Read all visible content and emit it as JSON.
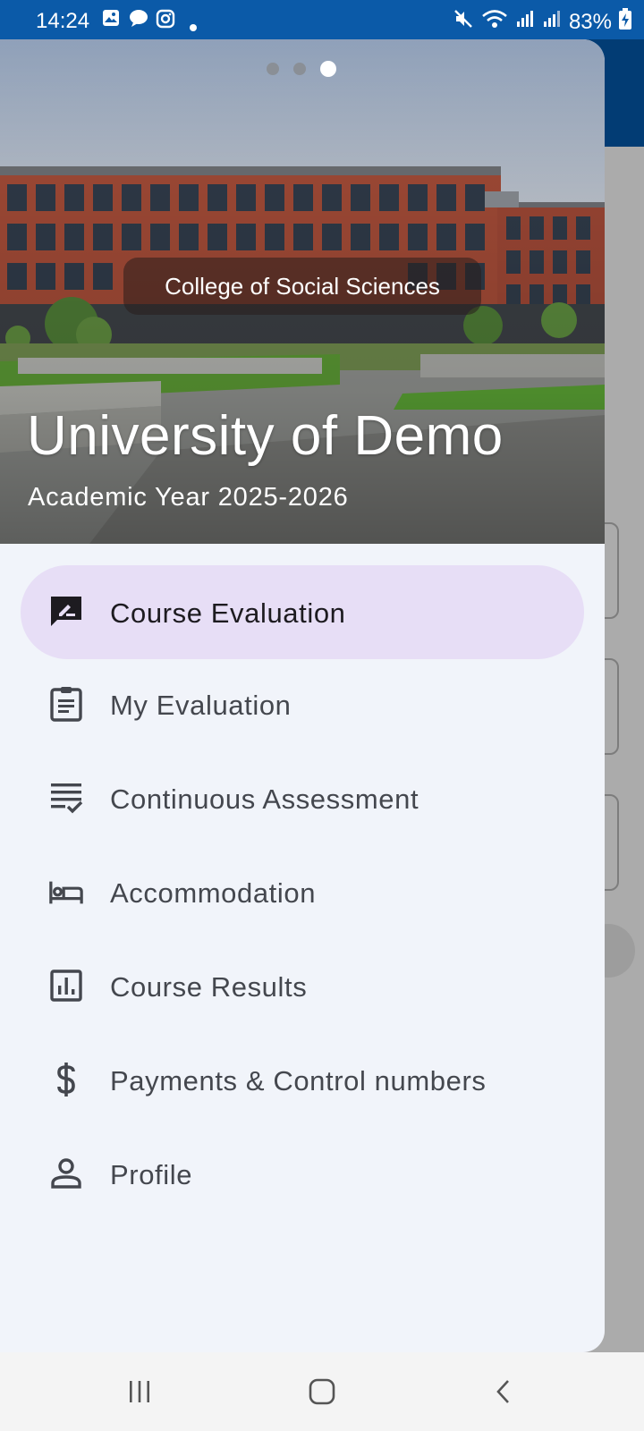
{
  "status_bar": {
    "time": "14:24",
    "battery": "83%",
    "icons": [
      "gallery-icon",
      "chat-bubble-icon",
      "instagram-icon",
      "dot-icon",
      "mute-icon",
      "wifi-icon",
      "signal-icon",
      "signal-icon",
      "battery-charging-icon"
    ]
  },
  "colors": {
    "status_bar": "#0b5aa8",
    "app_bar": "#023c74",
    "drawer_bg": "#f1f4fa",
    "active_pill": "#e7def6",
    "text": "#44474e"
  },
  "header": {
    "carousel_dots": 3,
    "carousel_active_index": 2,
    "college": "College of Social Sciences",
    "university": "University of Demo",
    "academic_year": "Academic Year 2025-2026"
  },
  "menu": {
    "items": [
      {
        "label": "Course Evaluation",
        "icon": "rate-review-icon",
        "active": true
      },
      {
        "label": "My Evaluation",
        "icon": "clipboard-icon",
        "active": false
      },
      {
        "label": "Continuous Assessment",
        "icon": "checklist-icon",
        "active": false
      },
      {
        "label": "Accommodation",
        "icon": "bed-icon",
        "active": false
      },
      {
        "label": "Course Results",
        "icon": "bar-chart-icon",
        "active": false
      },
      {
        "label": "Payments & Control numbers",
        "icon": "dollar-icon",
        "active": false
      },
      {
        "label": "Profile",
        "icon": "person-icon",
        "active": false
      }
    ]
  },
  "nav_bar": {
    "buttons": [
      "recent-apps-icon",
      "home-icon",
      "back-icon"
    ]
  }
}
